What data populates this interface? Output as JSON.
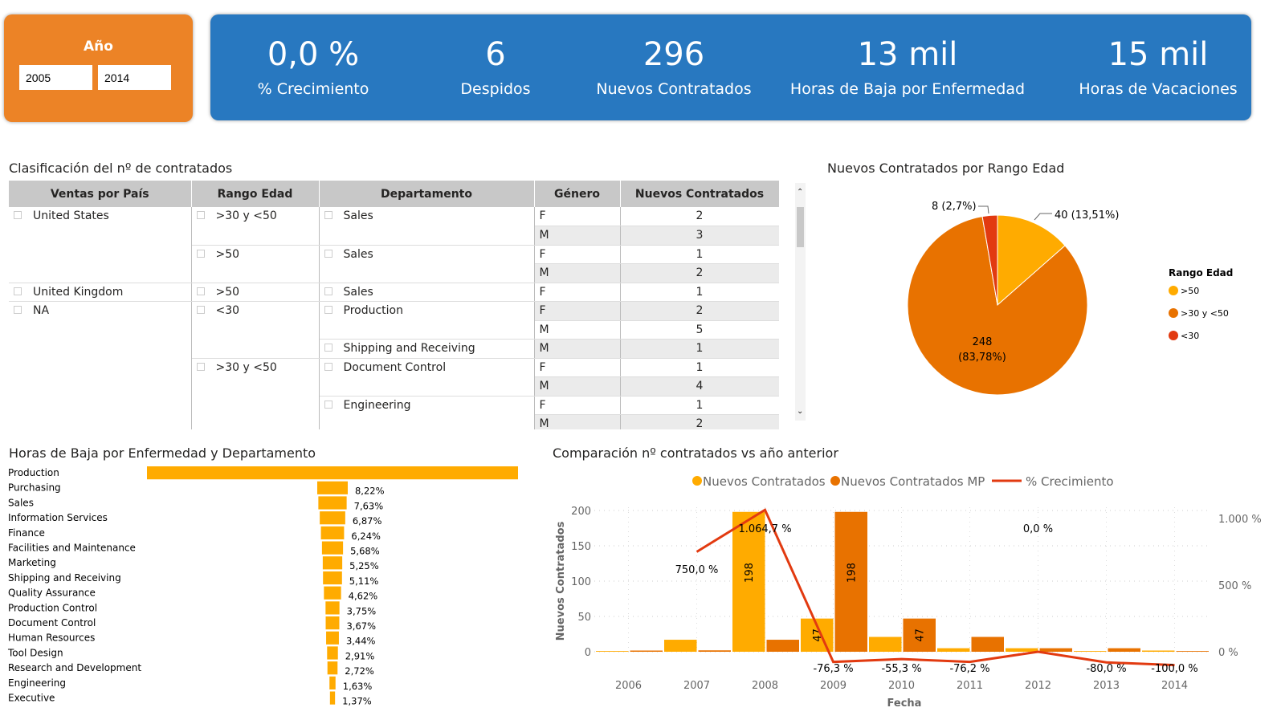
{
  "filter": {
    "title": "Año",
    "from": "2005",
    "to": "2014"
  },
  "kpis": [
    {
      "value": "0,0 %",
      "label": "% Crecimiento"
    },
    {
      "value": "6",
      "label": "Despidos"
    },
    {
      "value": "296",
      "label": "Nuevos Contratados"
    },
    {
      "value": "13 mil",
      "label": "Horas de Baja por Enfermedad"
    },
    {
      "value": "15 mil",
      "label": "Horas de Vacaciones"
    }
  ],
  "matrix": {
    "title": "Clasificación del nº de contratados",
    "headers": [
      "Ventas por País",
      "Rango Edad",
      "Departamento",
      "Género",
      "Nuevos Contratados"
    ],
    "rows": [
      {
        "country": "United States",
        "ranges": [
          {
            "range": ">30 y <50",
            "depts": [
              {
                "dept": "Sales",
                "g": [
                  [
                    "F",
                    "2"
                  ],
                  [
                    "M",
                    "3"
                  ]
                ]
              }
            ]
          },
          {
            "range": ">50",
            "depts": [
              {
                "dept": "Sales",
                "g": [
                  [
                    "F",
                    "1"
                  ],
                  [
                    "M",
                    "2"
                  ]
                ]
              }
            ]
          }
        ]
      },
      {
        "country": "United Kingdom",
        "ranges": [
          {
            "range": ">50",
            "depts": [
              {
                "dept": "Sales",
                "g": [
                  [
                    "F",
                    "1"
                  ]
                ]
              }
            ]
          }
        ]
      },
      {
        "country": "NA",
        "ranges": [
          {
            "range": "<30",
            "depts": [
              {
                "dept": "Production",
                "g": [
                  [
                    "F",
                    "2"
                  ],
                  [
                    "M",
                    "5"
                  ]
                ]
              },
              {
                "dept": "Shipping and Receiving",
                "g": [
                  [
                    "M",
                    "1"
                  ]
                ]
              }
            ]
          },
          {
            "range": ">30 y <50",
            "depts": [
              {
                "dept": "Document Control",
                "g": [
                  [
                    "F",
                    "1"
                  ],
                  [
                    "M",
                    "4"
                  ]
                ]
              },
              {
                "dept": "Engineering",
                "g": [
                  [
                    "F",
                    "1"
                  ],
                  [
                    "M",
                    "2"
                  ]
                ]
              }
            ]
          }
        ]
      }
    ]
  },
  "chart_data": [
    {
      "type": "pie",
      "title": "Nuevos Contratados por Rango Edad",
      "legend_title": "Rango Edad",
      "legend_position": "right",
      "slices": [
        {
          "name": ">50",
          "value": 40,
          "label": "40 (13,51%)",
          "color": "#ffab00"
        },
        {
          "name": ">30 y <50",
          "value": 248,
          "label": "248\n(83,78%)",
          "label_lines": [
            "248",
            "(83,78%)"
          ],
          "color": "#e87200"
        },
        {
          "name": "<30",
          "value": 8,
          "label": "8 (2,7%)",
          "color": "#e23a10"
        }
      ]
    },
    {
      "type": "bar",
      "orientation": "funnel",
      "title": "Horas de Baja por Enfermedad y Departamento",
      "color": "#ffab00",
      "categories": [
        "Production",
        "Purchasing",
        "Sales",
        "Information Services",
        "Finance",
        "Facilities and Maintenance",
        "Marketing",
        "Shipping and Receiving",
        "Quality Assurance",
        "Production Control",
        "Document Control",
        "Human Resources",
        "Tool Design",
        "Research and Development",
        "Engineering",
        "Executive"
      ],
      "values": [
        100,
        8.22,
        7.63,
        6.87,
        6.24,
        5.68,
        5.25,
        5.11,
        4.62,
        3.75,
        3.67,
        3.44,
        2.91,
        2.72,
        1.63,
        1.37
      ],
      "labels": [
        "",
        "8,22%",
        "7,63%",
        "6,87%",
        "6,24%",
        "5,68%",
        "5,25%",
        "5,11%",
        "4,62%",
        "3,75%",
        "3,67%",
        "3,44%",
        "2,91%",
        "2,72%",
        "1,63%",
        "1,37%"
      ]
    },
    {
      "type": "bar+line",
      "title": "Comparación nº contratados vs año anterior",
      "xlabel": "Fecha",
      "ylabel": "Nuevos Contratados",
      "categories": [
        "2006",
        "2007",
        "2008",
        "2009",
        "2010",
        "2011",
        "2012",
        "2013",
        "2014"
      ],
      "ylim": [
        0,
        200
      ],
      "yticks": [
        "0",
        "50",
        "100",
        "150",
        "200"
      ],
      "y2ticks": [
        "0 %",
        "500 %",
        "1.000 %"
      ],
      "y2lim": [
        0,
        1000
      ],
      "grid": true,
      "legend_position": "top",
      "series": [
        {
          "name": "Nuevos Contratados",
          "kind": "bar",
          "color": "#ffab00",
          "values": [
            1,
            17,
            198,
            47,
            21,
            5,
            5,
            1,
            0
          ],
          "labels": [
            "",
            "",
            "198",
            "47",
            "",
            "",
            "",
            "",
            ""
          ]
        },
        {
          "name": "Nuevos Contratados MP",
          "kind": "bar",
          "color": "#e87200",
          "values": [
            0,
            2,
            17,
            198,
            47,
            21,
            5,
            5,
            1
          ],
          "labels": [
            "",
            "",
            "",
            "198",
            "47",
            "",
            "",
            "",
            ""
          ]
        },
        {
          "name": "% Crecimiento",
          "kind": "line",
          "color": "#e23a10",
          "values": [
            null,
            750.0,
            1064.7,
            -76.3,
            -55.3,
            -76.2,
            0.0,
            -80.0,
            -100.0
          ],
          "labels": [
            "",
            "750,0 %",
            "1.064,7 %",
            "-76,3 %",
            "-55,3 %",
            "-76,2 %",
            "0,0 %",
            "-80,0 %",
            "-100,0 %"
          ]
        }
      ]
    }
  ]
}
